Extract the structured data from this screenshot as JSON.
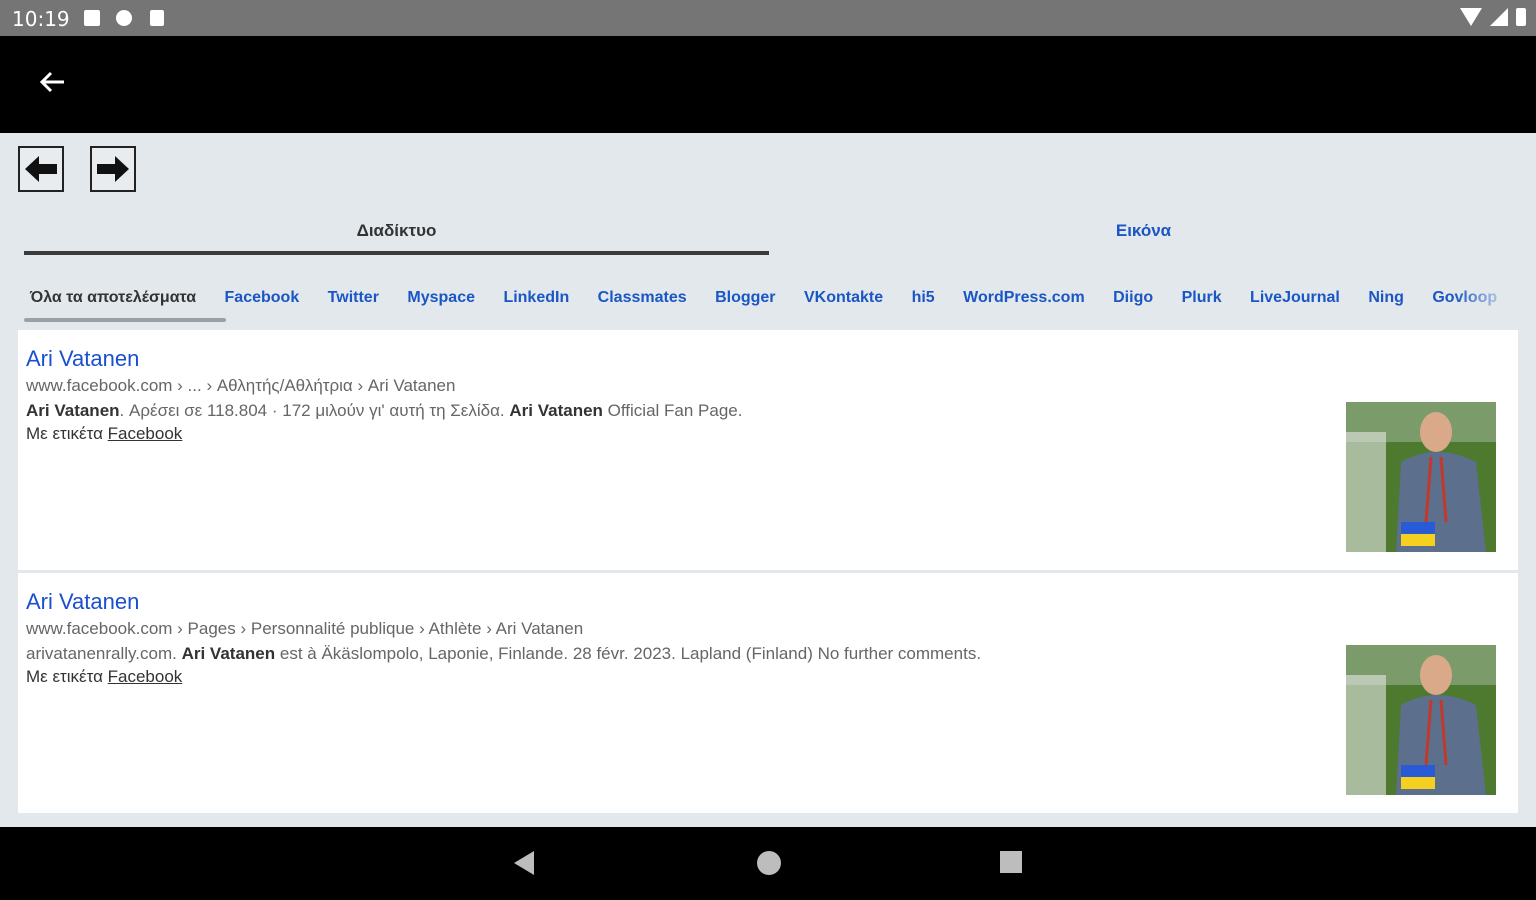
{
  "status_bar": {
    "time": "10:19"
  },
  "tabs": [
    {
      "label": "Διαδίκτυο"
    },
    {
      "label": "Εικόνα"
    }
  ],
  "filters": [
    "Όλα τα αποτελέσματα",
    "Facebook",
    "Twitter",
    "Myspace",
    "LinkedIn",
    "Classmates",
    "Blogger",
    "VKontakte",
    "hi5",
    "WordPress.com",
    "Diigo",
    "Plurk",
    "LiveJournal",
    "Ning",
    "Govloop"
  ],
  "results": [
    {
      "title": "Ari Vatanen",
      "url": "www.facebook.com › ... › Αθλητής/Αθλήτρια › Ari Vatanen",
      "snippet_b1": "Ari Vatanen",
      "snippet_t1": ". Αρέσει σε 118.804 · 172 μιλούν γι' αυτή τη Σελίδα. ",
      "snippet_b2": "Ari Vatanen",
      "snippet_t2": " Official Fan Page.",
      "tag_prefix": "Με ετικέτα ",
      "tag_link": "Facebook"
    },
    {
      "title": "Ari Vatanen",
      "url": "www.facebook.com › Pages › Personnalité publique › Athlète › Ari Vatanen",
      "snippet_b1": "",
      "snippet_t1": "arivatanenrally.com. ",
      "snippet_b2": "Ari Vatanen",
      "snippet_t2": " est à Äkäslompolo, Laponie, Finlande. 28 févr. 2023. Lapland (Finland) No further comments.",
      "tag_prefix": "Με ετικέτα ",
      "tag_link": "Facebook"
    }
  ]
}
